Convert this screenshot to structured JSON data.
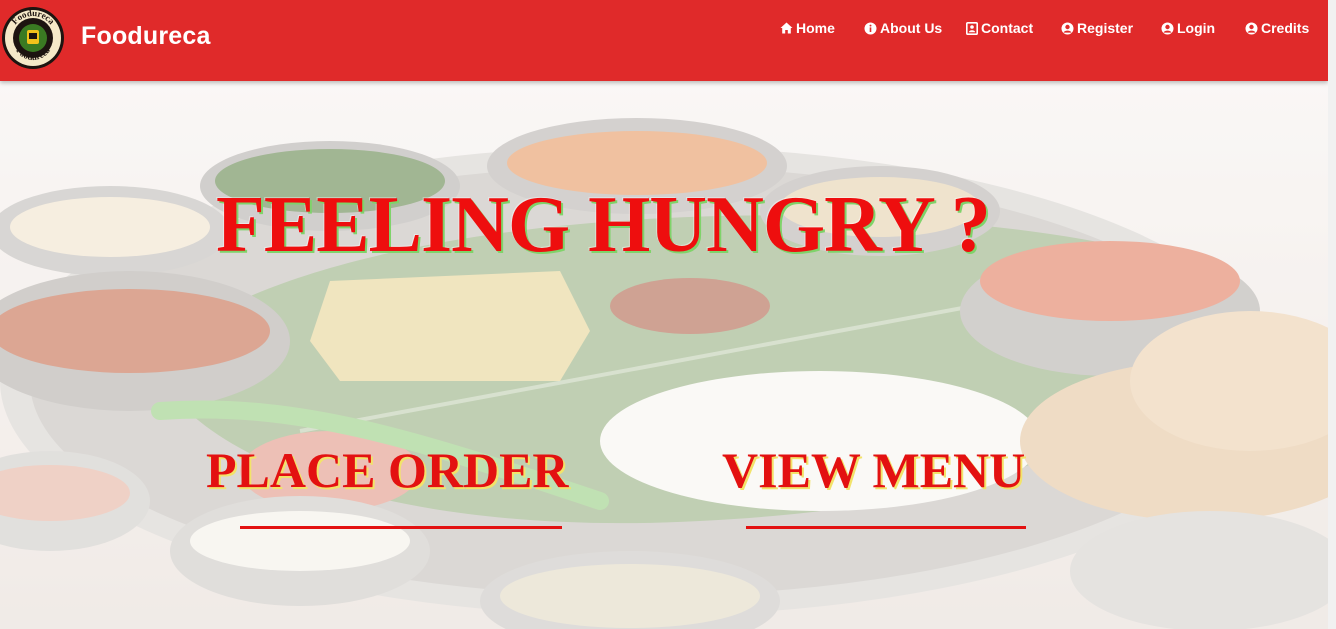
{
  "brand": {
    "name": "Foodureca",
    "logo_text_top": "Foodureca",
    "logo_text_bottom": "Foodureca"
  },
  "nav": {
    "items": [
      {
        "label": "Home",
        "icon": "home-icon"
      },
      {
        "label": "About Us",
        "icon": "info-circle-icon"
      },
      {
        "label": "Contact",
        "icon": "contact-card-icon"
      },
      {
        "label": "Register",
        "icon": "user-circle-icon"
      },
      {
        "label": "Login",
        "icon": "user-circle-icon"
      },
      {
        "label": "Credits",
        "icon": "user-circle-icon"
      }
    ]
  },
  "hero": {
    "headline": "FEELING HUNGRY ?",
    "place_order_label": "PLACE ORDER",
    "view_menu_label": "VIEW MENU",
    "background": "thali-food-platter-image"
  },
  "colors": {
    "navbar": "#e02a2a",
    "headline": "#ee0e0e",
    "headline_shadow": "#7fd36a",
    "cta": "#e31111",
    "cta_shadow": "#f2e36a"
  }
}
